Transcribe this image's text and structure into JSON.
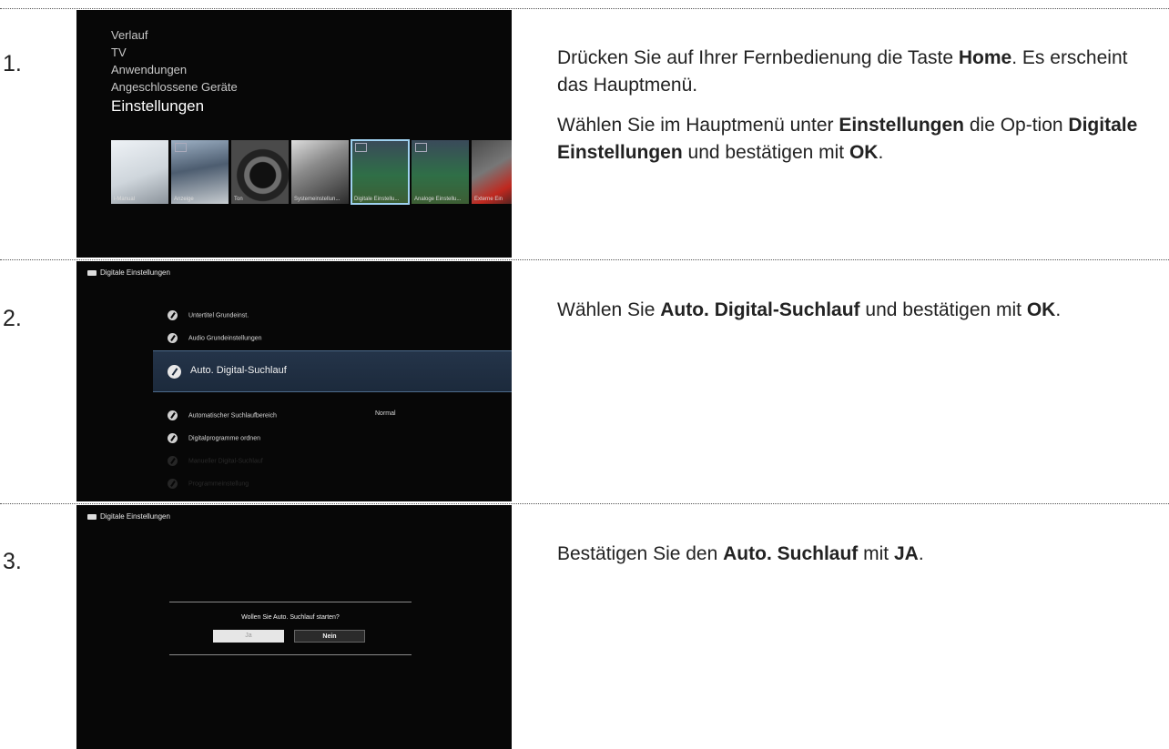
{
  "steps": [
    {
      "number": "1.",
      "screen": {
        "menu": [
          "Verlauf",
          "TV",
          "Anwendungen",
          "Angeschlossene Geräte",
          "Einstellungen"
        ],
        "tiles": [
          "i-Manual",
          "Anzeige",
          "Ton",
          "Systemeinstellun...",
          "Digitale Einstellu...",
          "Analoge Einstellu...",
          "Externe Ein"
        ]
      },
      "p1": {
        "a": "Drücken Sie auf Ihrer Fernbedienung die Taste ",
        "b": "Home",
        "c": ". Es erscheint das Hauptmenü."
      },
      "p2": {
        "a": "Wählen Sie im Hauptmenü unter ",
        "b": "Einstellungen",
        "c": " die Op-tion ",
        "d": "Digitale Einstellungen",
        "e": " und bestätigen mit ",
        "f": "OK",
        "g": "."
      }
    },
    {
      "number": "2.",
      "screen": {
        "header": "Digitale Einstellungen",
        "items": [
          "Untertitel Grundeinst.",
          "Audio Grundeinstellungen"
        ],
        "highlight": "Auto. Digital-Suchlauf",
        "items_after": [
          "Automatischer Suchlaufbereich",
          "Digitalprogramme ordnen",
          "Manueller Digital-Suchlauf",
          "Programmeinstellung"
        ],
        "value_normal": "Normal"
      },
      "p1": {
        "a": "Wählen Sie ",
        "b": "Auto. Digital-Suchlauf",
        "c": " und bestätigen mit ",
        "d": "OK",
        "e": "."
      }
    },
    {
      "number": "3.",
      "screen": {
        "header": "Digitale Einstellungen",
        "question": "Wollen Sie Auto. Suchlauf starten?",
        "yes": "Ja",
        "no": "Nein"
      },
      "p1": {
        "a": "Bestätigen Sie den ",
        "b": "Auto. Suchlauf",
        "c": " mit ",
        "d": "JA",
        "e": "."
      }
    }
  ]
}
